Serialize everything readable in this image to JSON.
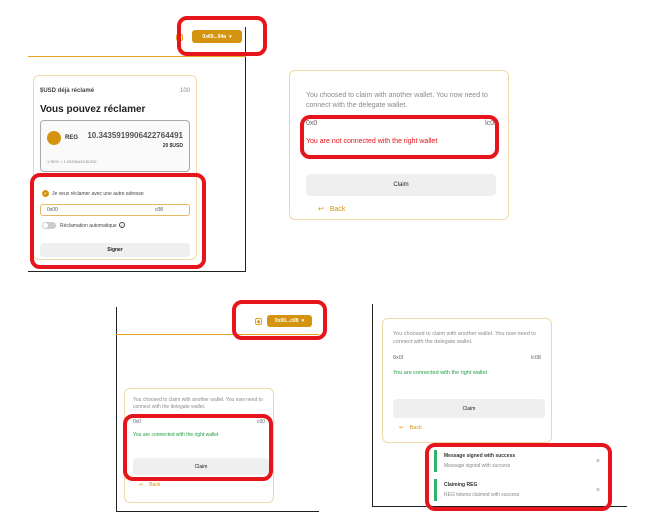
{
  "p1": {
    "wallet_address": "0x69...94a",
    "claimed_label": "$USD déjà réclamé",
    "claimed_value": "100",
    "heading": "Vous pouvez réclamer",
    "token": "REG",
    "amount": "10.3435919906422764491",
    "usd_value": "20 $USD",
    "rate": "1 REG = 1.93356428 $USD",
    "checkbox_label": "Je veux réclamer avec une autre adresse",
    "address_start": "0x00",
    "address_end": "c08",
    "auto_label": "Réclamation automatique",
    "sign_button": "Signer"
  },
  "p2": {
    "message": "You choosed to claim with another wallet. You now need to connect with the delegate wallet.",
    "address_start": "0x0",
    "address_end": "lc00",
    "status": "You are not connected with the right wallet",
    "claim_button": "Claim",
    "back": "Back"
  },
  "p3": {
    "wallet_address": "0x00...c08",
    "message": "You choosed to claim with another wallet. You now need to connect with the delegate wallet.",
    "address_start": "0x0",
    "address_end": "c00",
    "status": "You are connected with the right wallet",
    "claim_button": "Claim",
    "back": "Back"
  },
  "p4": {
    "message": "You choosed to claim with another wallet. You now need to connect with the delegate wallet.",
    "address_start": "0x0l",
    "address_end": "lc08",
    "status": "You are connected with the right wallet",
    "claim_button": "Claim",
    "back": "Back",
    "toasts": [
      {
        "title": "Message signed with success",
        "body": "Message signed with success"
      },
      {
        "title": "Claiming REG",
        "body": "REG tokens claimed with success"
      }
    ]
  },
  "colors": {
    "accent": "#d4940f",
    "highlight": "#e6141b",
    "success": "#21a042",
    "toast_bar": "#2fb36a"
  }
}
